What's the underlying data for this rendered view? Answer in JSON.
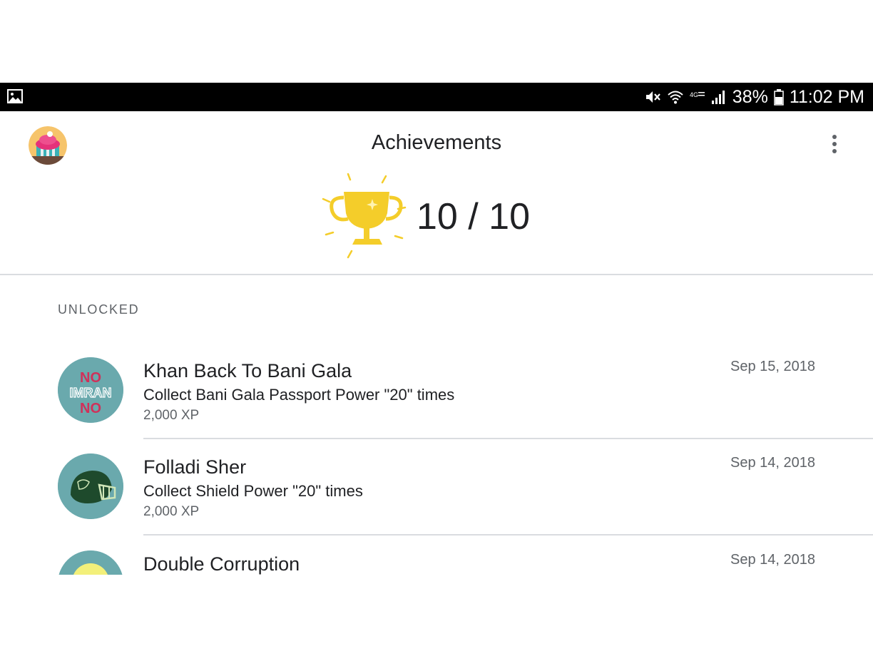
{
  "status_bar": {
    "battery": "38%",
    "time": "11:02 PM",
    "left_icon": "gallery-icon",
    "right_icons": [
      "mute-icon",
      "wifi-icon",
      "volte-icon",
      "signal-icon",
      "battery-icon"
    ]
  },
  "header": {
    "title": "Achievements",
    "avatar_icon": "cupcake-avatar",
    "menu_icon": "more-vert-icon"
  },
  "summary": {
    "score": "10 / 10",
    "trophy_icon": "trophy-icon"
  },
  "section": {
    "label": "UNLOCKED"
  },
  "achievements": [
    {
      "title": "Khan Back To Bani Gala",
      "description": "Collect Bani Gala Passport Power \"20\" times",
      "xp": "2,000 XP",
      "date": "Sep 15, 2018",
      "badge_text": [
        "NO",
        "IMRAN",
        "NO"
      ]
    },
    {
      "title": "Folladi Sher",
      "description": "Collect Shield Power \"20\" times",
      "xp": "2,000 XP",
      "date": "Sep 14, 2018",
      "badge_icon": "helmet-icon"
    },
    {
      "title": "Double Corruption",
      "description": "",
      "xp": "",
      "date": "Sep 14, 2018",
      "badge_icon": "yellow-coin-icon"
    }
  ],
  "colors": {
    "trophy": "#f4cd2a",
    "badge_bg": "#6aa9ad",
    "divider": "#dadce0",
    "secondary_text": "#5f6368"
  }
}
